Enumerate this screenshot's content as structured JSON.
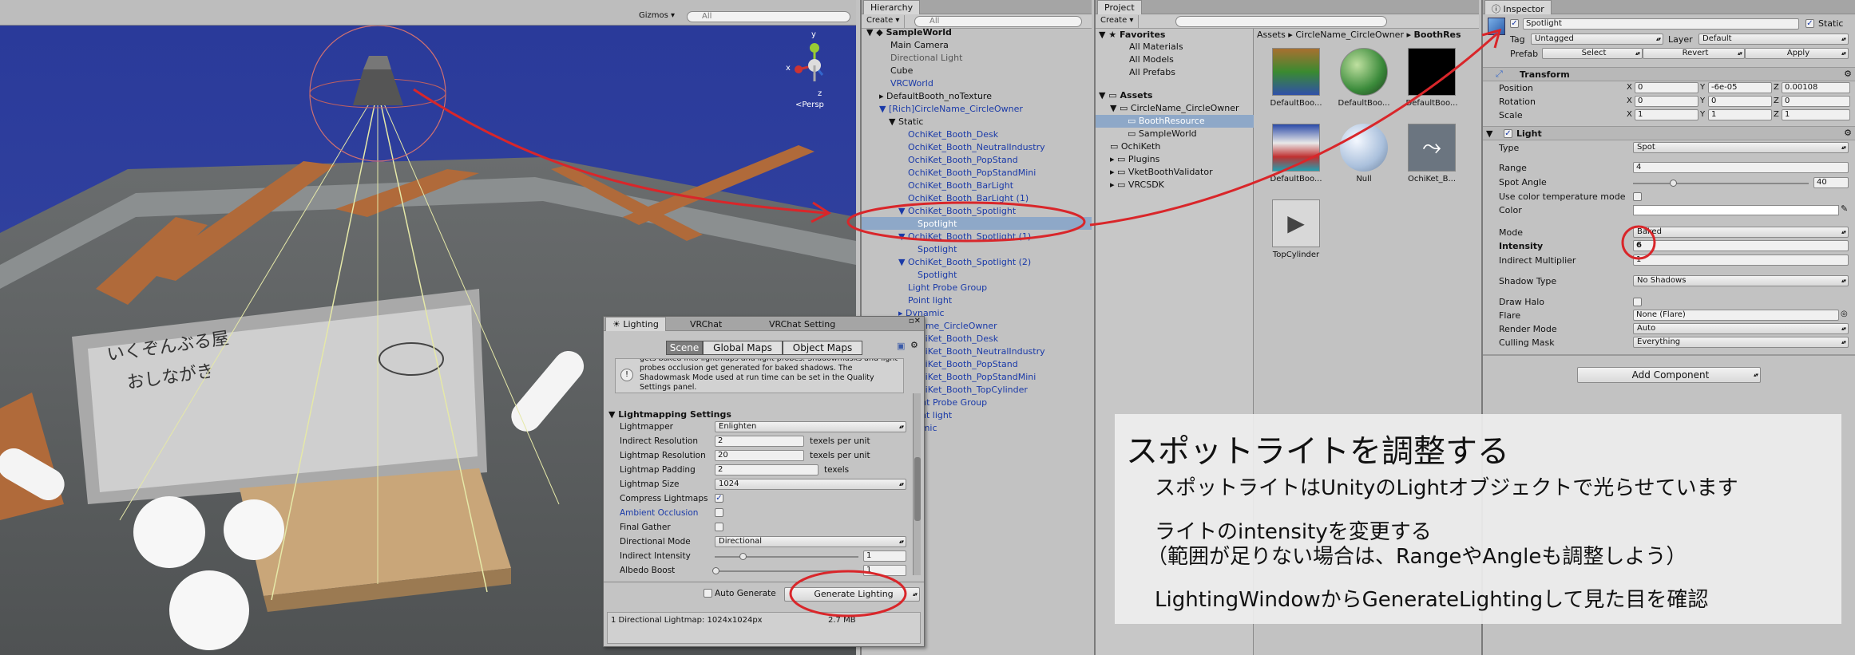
{
  "scene": {
    "toolbar": {
      "gizmos_label": "Gizmos ▾",
      "search_placeholder": "All"
    },
    "gizmo": {
      "x_label": "x",
      "y_label": "y",
      "z_label": "z",
      "persp_label": "<Persp"
    },
    "whiteboard_text": {
      "line1": "いくぞんぶる屋",
      "line2": "おしながき"
    }
  },
  "hierarchy": {
    "tab_label": "Hierarchy",
    "create_label": "Create ▾",
    "search_placeholder": "All",
    "scene_name": "SampleWorld",
    "items": [
      {
        "label": "Main Camera"
      },
      {
        "label": "Directional Light"
      },
      {
        "label": "Cube"
      },
      {
        "label": "VRCWorld"
      },
      {
        "label": "DefaultBooth_noTexture"
      },
      {
        "label": "[Rich]CircleName_CircleOwner"
      },
      {
        "label": "Static"
      },
      {
        "label": "OchiKet_Booth_Desk"
      },
      {
        "label": "OchiKet_Booth_NeutralIndustry"
      },
      {
        "label": "OchiKet_Booth_PopStand"
      },
      {
        "label": "OchiKet_Booth_PopStandMini"
      },
      {
        "label": "OchiKet_Booth_BarLight"
      },
      {
        "label": "OchiKet_Booth_BarLight (1)"
      },
      {
        "label": "OchiKet_Booth_Spotlight"
      },
      {
        "label": "Spotlight"
      },
      {
        "label": "OchiKet_Booth_Spotlight (1)"
      },
      {
        "label": "Spotlight"
      },
      {
        "label": "OchiKet_Booth_Spotlight (2)"
      },
      {
        "label": "Spotlight"
      },
      {
        "label": "Light Probe Group"
      },
      {
        "label": "Point light"
      },
      {
        "label": "Dynamic"
      },
      {
        "label": "CircleName_CircleOwner"
      },
      {
        "label": "OchiKet_Booth_Desk"
      },
      {
        "label": "OchiKet_Booth_NeutralIndustry"
      },
      {
        "label": "OchiKet_Booth_PopStand"
      },
      {
        "label": "OchiKet_Booth_PopStandMini"
      },
      {
        "label": "OchiKet_Booth_TopCylinder"
      },
      {
        "label": "Light Probe Group"
      },
      {
        "label": "Point light"
      },
      {
        "label": "Dynamic"
      }
    ]
  },
  "project": {
    "tab_label": "Project",
    "create_label": "Create ▾",
    "favorites_label": "Favorites",
    "favorites": [
      "All Materials",
      "All Models",
      "All Prefabs"
    ],
    "assets_label": "Assets",
    "assets_tree": [
      "CircleName_CircleOwner",
      "BoothResource",
      "SampleWorld",
      "OchiKeth",
      "Plugins",
      "VketBoothValidator",
      "VRCSDK"
    ],
    "breadcrumb": [
      "Assets",
      "CircleName_CircleOwner",
      "BoothRes"
    ],
    "grid": [
      "DefaultBoo...",
      "DefaultBoo...",
      "DefaultBoo...",
      "DefaultBoo...",
      "Null",
      "OchiKet_B...",
      "TopCylinder"
    ]
  },
  "inspector": {
    "tab_label": "Inspector",
    "object_name": "Spotlight",
    "static_label": "Static",
    "tag_label": "Tag",
    "tag_value": "Untagged",
    "layer_label": "Layer",
    "layer_value": "Default",
    "prefab_label": "Prefab",
    "select_label": "Select",
    "revert_label": "Revert",
    "apply_label": "Apply",
    "transform": {
      "title": "Transform",
      "position_label": "Position",
      "px": "0",
      "py": "-6e-05",
      "pz": "0.00108",
      "rotation_label": "Rotation",
      "rx": "0",
      "ry": "0",
      "rz": "0",
      "scale_label": "Scale",
      "sx": "1",
      "sy": "1",
      "sz": "1",
      "x": "X",
      "y": "Y",
      "z": "Z"
    },
    "light": {
      "title": "Light",
      "type_label": "Type",
      "type_value": "Spot",
      "range_label": "Range",
      "range_value": "4",
      "spot_angle_label": "Spot Angle",
      "spot_angle_value": "40",
      "use_color_temp_label": "Use color temperature mode",
      "color_label": "Color",
      "mode_label": "Mode",
      "mode_value": "Baked",
      "intensity_label": "Intensity",
      "intensity_value": "6",
      "indirect_label": "Indirect Multiplier",
      "indirect_value": "1",
      "shadow_label": "Shadow Type",
      "shadow_value": "No Shadows",
      "draw_halo_label": "Draw Halo",
      "flare_label": "Flare",
      "flare_value": "None (Flare)",
      "render_mode_label": "Render Mode",
      "render_mode_value": "Auto",
      "culling_label": "Culling Mask",
      "culling_value": "Everything"
    },
    "add_component_label": "Add Component"
  },
  "lighting": {
    "tabs": [
      "Lighting",
      "VRChat",
      "VRChat Setting"
    ],
    "subtabs": [
      "Scene",
      "Global Maps",
      "Object Maps"
    ],
    "info_text": "gets baked into lightmaps and light probes. Shadowmasks and light probes occlusion get generated for baked shadows. The Shadowmask Mode used at run time can be set in the Quality Settings panel.",
    "section_label": "Lightmapping Settings",
    "lightmapper_label": "Lightmapper",
    "lightmapper_value": "Enlighten",
    "indirect_res_label": "Indirect Resolution",
    "indirect_res_value": "2",
    "lightmap_res_label": "Lightmap Resolution",
    "lightmap_res_value": "20",
    "padding_label": "Lightmap Padding",
    "padding_value": "2",
    "size_label": "Lightmap Size",
    "size_value": "1024",
    "compress_label": "Compress Lightmaps",
    "ao_label": "Ambient Occlusion",
    "final_gather_label": "Final Gather",
    "dir_mode_label": "Directional Mode",
    "dir_mode_value": "Directional",
    "indirect_int_label": "Indirect Intensity",
    "indirect_int_value": "1",
    "albedo_label": "Albedo Boost",
    "albedo_value": "1",
    "texels_unit": "texels per unit",
    "texels": "texels",
    "auto_generate_label": "Auto Generate",
    "generate_label": "Generate Lighting",
    "status_text": "1 Directional Lightmap: 1024x1024px",
    "status_size": "2.7 MB"
  },
  "caption": {
    "title": "スポットライトを調整する",
    "line1": "スポットライトはUnityのLightオブジェクトで光らせています",
    "line2": "ライトのintensityを変更する",
    "line3": "（範囲が足りない場合は、RangeやAngleも調整しよう）",
    "line4": "LightingWindowからGenerateLightingして見た目を確認"
  },
  "colors": {
    "annotation_red": "#d9262a",
    "selection_blue": "#8ea8c8",
    "link_blue": "#1a3aa8",
    "scene_sky": "#2d3f9a"
  }
}
